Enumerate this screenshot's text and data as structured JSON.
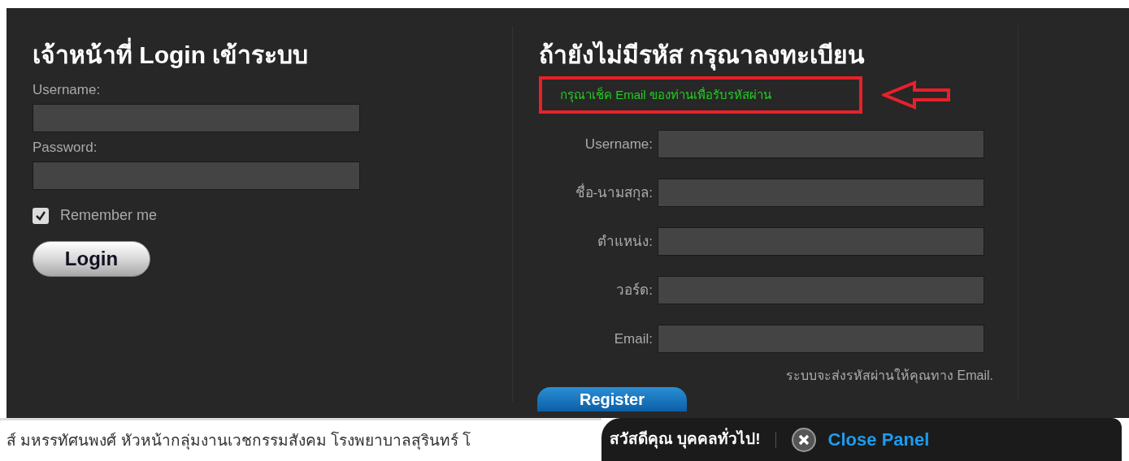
{
  "login": {
    "title": "เจ้าหน้าที่ Login เข้าระบบ",
    "fields": [
      {
        "label": "Username:"
      },
      {
        "label": "Password:"
      }
    ],
    "remember": {
      "label": "Remember me",
      "checked": true
    },
    "button": "Login"
  },
  "register": {
    "title": "ถ้ายังไม่มีรหัส กรุณาลงทะเบียน",
    "notice": "กรุณาเช็ค Email ของท่านเพื่อรับรหัสผ่าน",
    "fields": [
      {
        "label": "Username:"
      },
      {
        "label": "ชื่อ-นามสกุล:"
      },
      {
        "label": "ตำแหน่ง:"
      },
      {
        "label": "วอร์ด:"
      },
      {
        "label": "Email:"
      }
    ],
    "hint": "ระบบจะส่งรหัสผ่านให้คุณทาง Email.",
    "button": "Register"
  },
  "ticker": "ส์ มหรรทัศนพงศ์ หัวหน้ากลุ่มงานเวชกรรมสังคม โรงพยาบาลสุรินทร์ โ",
  "tab": {
    "greeting": "สวัสดีคุณ บุคคลทั่วไป!",
    "close": "Close Panel"
  }
}
